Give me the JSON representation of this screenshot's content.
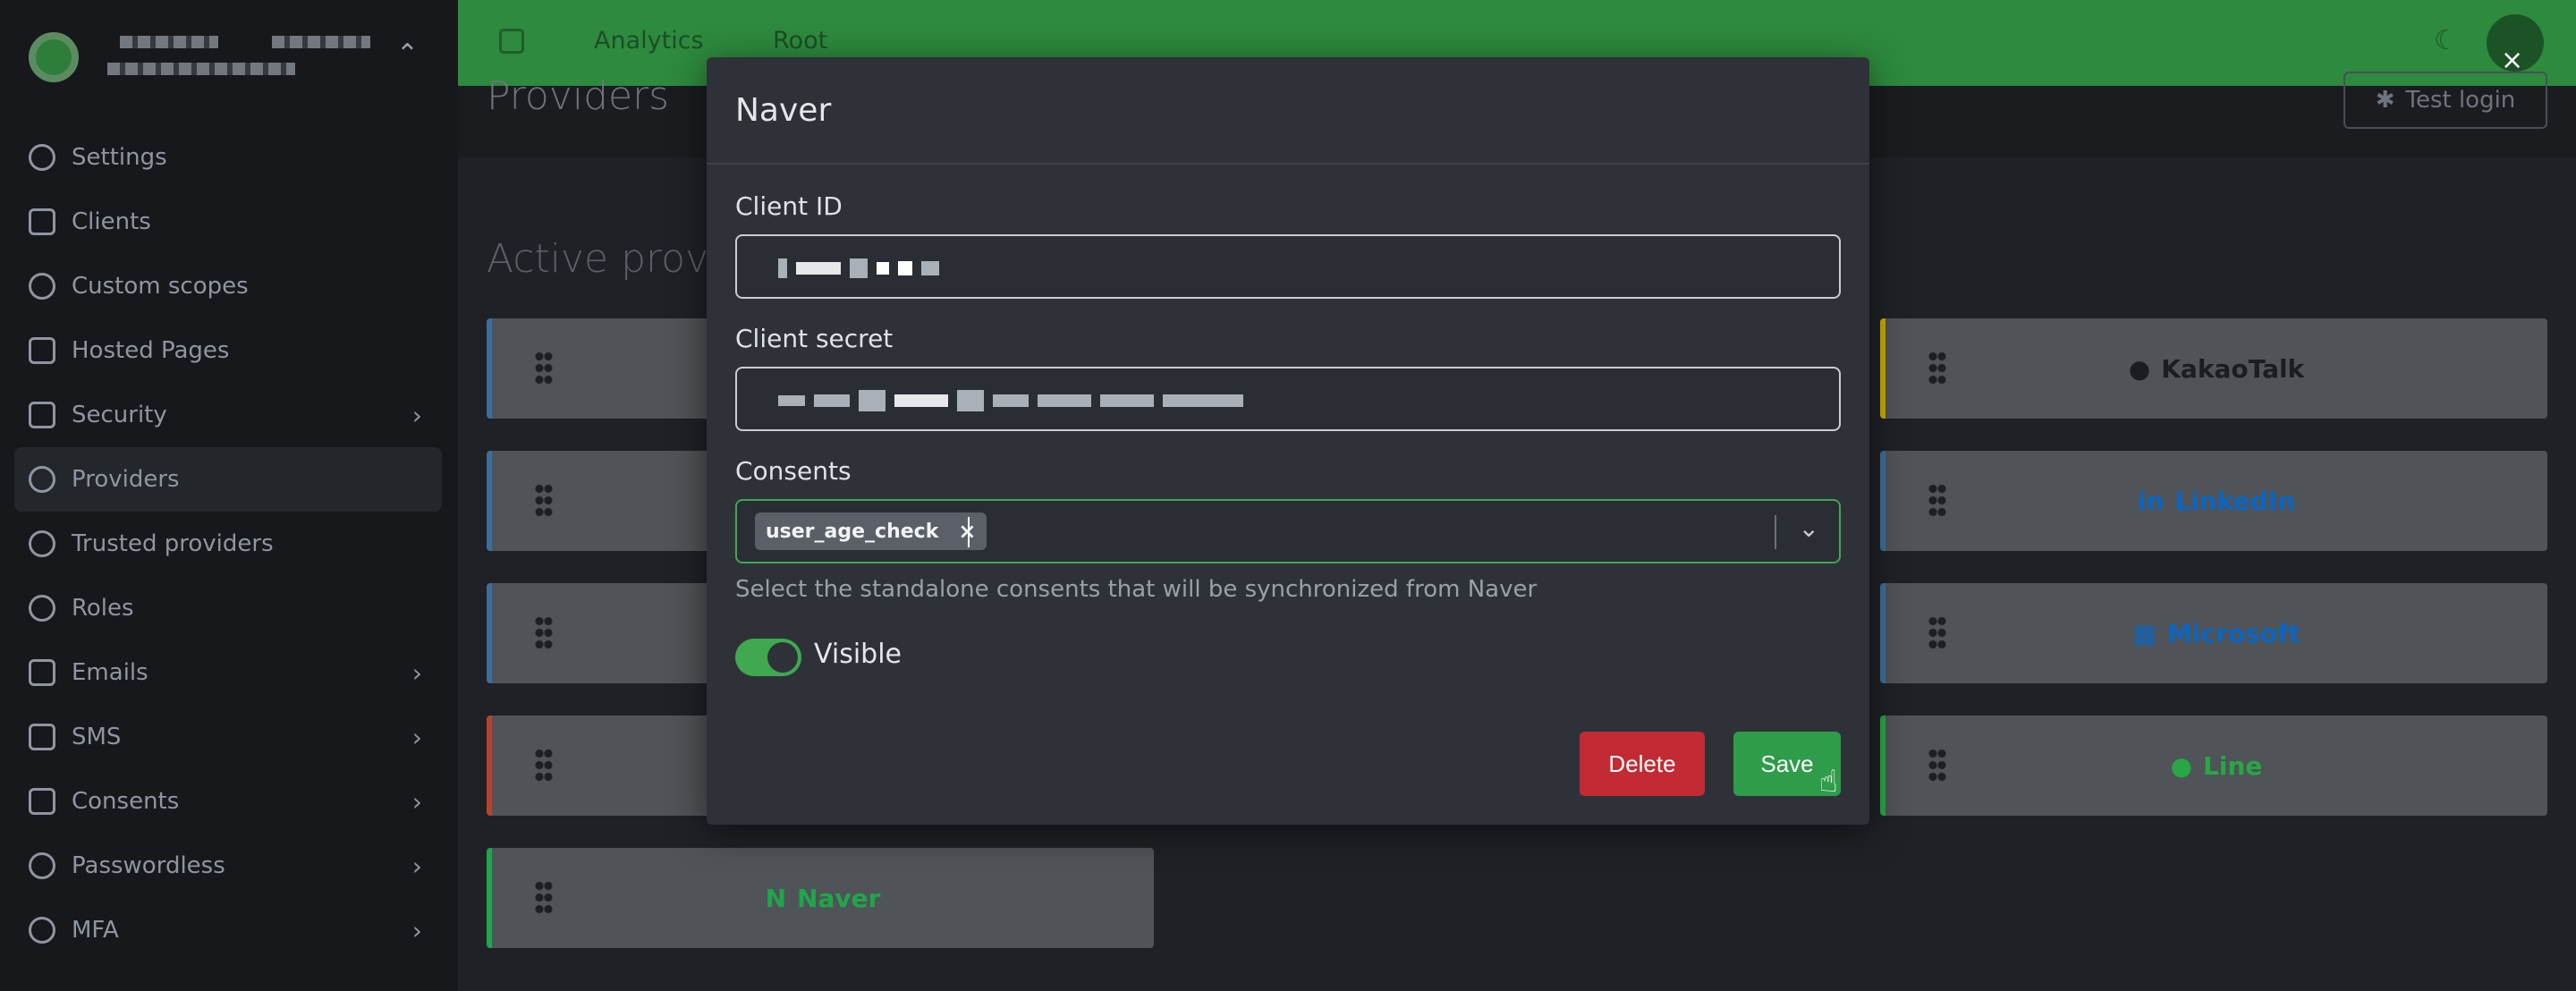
{
  "sidebar": {
    "items": [
      {
        "label": "Settings",
        "has_arrow": false
      },
      {
        "label": "Clients",
        "has_arrow": false
      },
      {
        "label": "Custom scopes",
        "has_arrow": false
      },
      {
        "label": "Hosted Pages",
        "has_arrow": false
      },
      {
        "label": "Security",
        "has_arrow": true
      },
      {
        "label": "Providers",
        "has_arrow": false,
        "active": true
      },
      {
        "label": "Trusted providers",
        "has_arrow": false
      },
      {
        "label": "Roles",
        "has_arrow": false
      },
      {
        "label": "Emails",
        "has_arrow": true
      },
      {
        "label": "SMS",
        "has_arrow": true
      },
      {
        "label": "Consents",
        "has_arrow": true
      },
      {
        "label": "Passwordless",
        "has_arrow": true
      },
      {
        "label": "MFA",
        "has_arrow": true
      }
    ]
  },
  "topbar": {
    "tabs": [
      "Analytics",
      "Root"
    ]
  },
  "page": {
    "title": "Providers",
    "test_login": "Test login",
    "active_section": "Active provid"
  },
  "providers": {
    "kakao": "KakaoTalk",
    "linkedin": "LinkedIn",
    "microsoft": "Microsoft",
    "line": "Line",
    "naver": "Naver"
  },
  "colors": {
    "kakao": "#c9a800",
    "linkedin": "#0a66c2",
    "microsoft": "#0a66c2",
    "line": "#27a745",
    "naver": "#1ea64b"
  },
  "modal": {
    "title": "Naver",
    "client_id_label": "Client ID",
    "client_secret_label": "Client secret",
    "consents_label": "Consents",
    "consent_chip": "user_age_check",
    "chip_remove": "×",
    "consents_help": "Select the standalone consents that will be synchronized from Naver",
    "visible_label": "Visible",
    "visible_on": true,
    "delete_label": "Delete",
    "save_label": "Save",
    "close_glyph": "×"
  }
}
